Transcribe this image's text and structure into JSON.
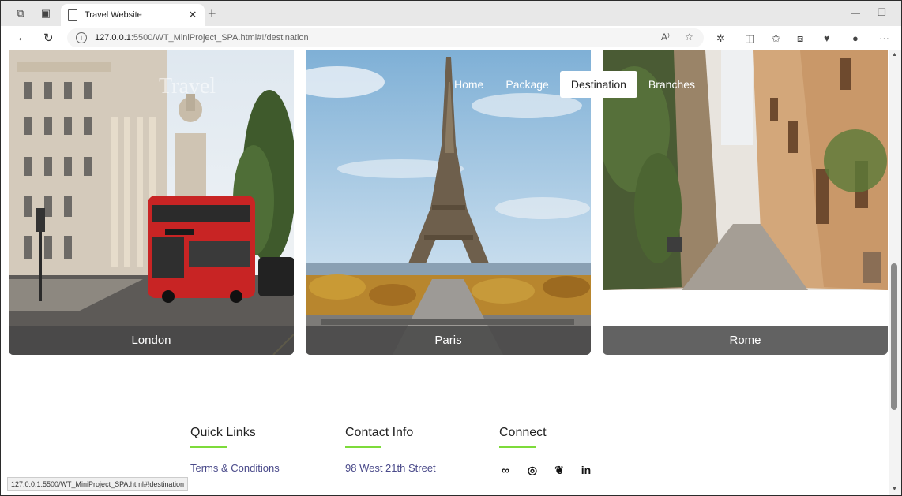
{
  "browser": {
    "tab_title": "Travel Website",
    "tab_close": "✕",
    "new_tab": "+",
    "url_host": "127.0.0.1",
    "url_path": ":5500/WT_MiniProject_SPA.html#!/destination",
    "status_url": "127.0.0.1:5500/WT_MiniProject_SPA.html#!destination",
    "icons": [
      "workspaces-icon",
      "tab-actions-icon",
      "back-icon",
      "refresh-icon",
      "info-icon",
      "read-aloud-icon",
      "favorite-icon",
      "extensions-icon",
      "split-screen-icon",
      "favorites-icon",
      "collections-icon",
      "browser-essentials-icon",
      "profile-icon",
      "more-icon"
    ]
  },
  "site": {
    "logo": "Travel",
    "nav": [
      {
        "label": "Home"
      },
      {
        "label": "Package"
      },
      {
        "label": "Destination",
        "active": true
      },
      {
        "label": "Branches"
      }
    ]
  },
  "destinations": [
    {
      "name": "London"
    },
    {
      "name": "Paris"
    },
    {
      "name": "Rome"
    }
  ],
  "footer": {
    "quick_links": {
      "heading": "Quick Links",
      "items": [
        "Terms & Conditions"
      ]
    },
    "contact": {
      "heading": "Contact Info",
      "items": [
        "98 West 21th Street"
      ]
    },
    "connect": {
      "heading": "Connect",
      "icons": [
        "meta-icon",
        "instagram-icon",
        "twitter-icon",
        "linkedin-icon"
      ]
    }
  },
  "colors": {
    "accent_underline": "#7ddb3a",
    "caption_bg": "#464646",
    "link": "#4a4a8a"
  }
}
